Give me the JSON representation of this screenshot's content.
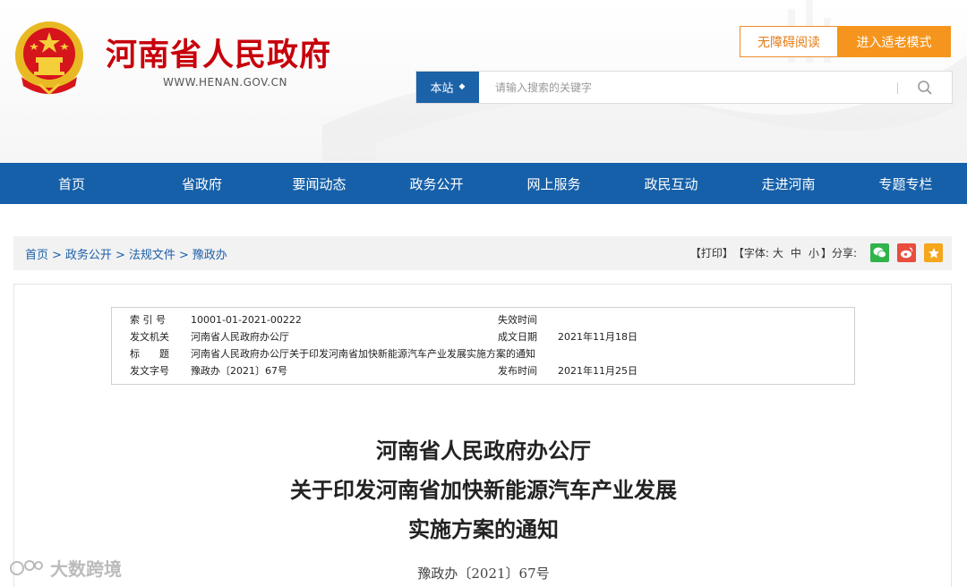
{
  "header": {
    "site_title": "河南省人民政府",
    "site_url": "WWW.HENAN.GOV.CN",
    "accessibility_button": "无障碍阅读",
    "elder_mode_button": "进入适老模式"
  },
  "search": {
    "scope_label": "本站",
    "placeholder": "请输入搜索的关键字"
  },
  "nav": {
    "items": [
      "首页",
      "省政府",
      "要闻动态",
      "政务公开",
      "网上服务",
      "政民互动",
      "走进河南",
      "专题专栏"
    ]
  },
  "breadcrumb": {
    "items": [
      "首页",
      "政务公开",
      "法规文件",
      "豫政办"
    ],
    "separator": ">"
  },
  "tools": {
    "print": "【打印】",
    "font_label": "【字体:",
    "font_large": "大",
    "font_medium": "中",
    "font_small": "小",
    "font_close": "】",
    "share_label": "分享:"
  },
  "meta": {
    "index_label": "索 引 号",
    "index_value": "10001-01-2021-00222",
    "expiry_label": "失效时间",
    "expiry_value": "",
    "issuer_label": "发文机关",
    "issuer_value": "河南省人民政府办公厅",
    "date_label": "成文日期",
    "date_value": "2021年11月18日",
    "title_label": "标　　题",
    "title_value": "河南省人民政府办公厅关于印发河南省加快新能源汽车产业发展实施方案的通知",
    "docno_label": "发文字号",
    "docno_value": "豫政办〔2021〕67号",
    "publish_label": "发布时间",
    "publish_value": "2021年11月25日"
  },
  "document": {
    "title_line1": "河南省人民政府办公厅",
    "title_line2": "关于印发河南省加快新能源汽车产业发展",
    "title_line3": "实施方案的通知",
    "number": "豫政办〔2021〕67号"
  },
  "watermark": "大数跨境",
  "colors": {
    "brand_red": "#c7000b",
    "nav_blue": "#1660a9",
    "accent_orange": "#f5951d"
  }
}
